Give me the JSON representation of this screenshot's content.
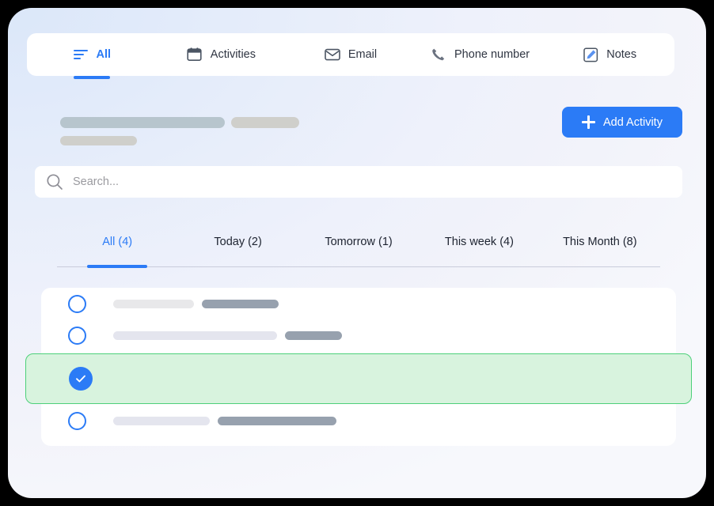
{
  "theme": {
    "accent_blue": "#2b7bf6",
    "success_green_bg": "#d8f3de",
    "success_green_border": "#4dd07a",
    "panel_white": "#ffffff"
  },
  "top_tabs": [
    {
      "label": "All",
      "icon": "list-lines-icon",
      "active": true
    },
    {
      "label": "Activities",
      "icon": "calendar-icon",
      "active": false
    },
    {
      "label": "Email",
      "icon": "envelope-icon",
      "active": false
    },
    {
      "label": "Phone number",
      "icon": "phone-icon",
      "active": false
    },
    {
      "label": "Notes",
      "icon": "edit-note-icon",
      "active": false
    }
  ],
  "header": {
    "add_activity_label": "Add Activity",
    "add_icon": "plus-icon"
  },
  "search": {
    "placeholder": "Search...",
    "value": "",
    "icon": "search-icon"
  },
  "filter_tabs": [
    {
      "label": "All (4)",
      "active": true
    },
    {
      "label": "Today (2)",
      "active": false
    },
    {
      "label": "Tomorrow (1)",
      "active": false
    },
    {
      "label": "This week (4)",
      "active": false
    },
    {
      "label": "This Month (8)",
      "active": false
    }
  ],
  "list": {
    "rows": [
      {
        "state": "pending",
        "checkbox_icon": "circle-outline-icon"
      },
      {
        "state": "pending",
        "checkbox_icon": "circle-outline-icon"
      },
      {
        "state": "completed",
        "checkbox_icon": "circle-check-filled-icon"
      },
      {
        "state": "pending",
        "checkbox_icon": "circle-outline-icon"
      }
    ]
  }
}
